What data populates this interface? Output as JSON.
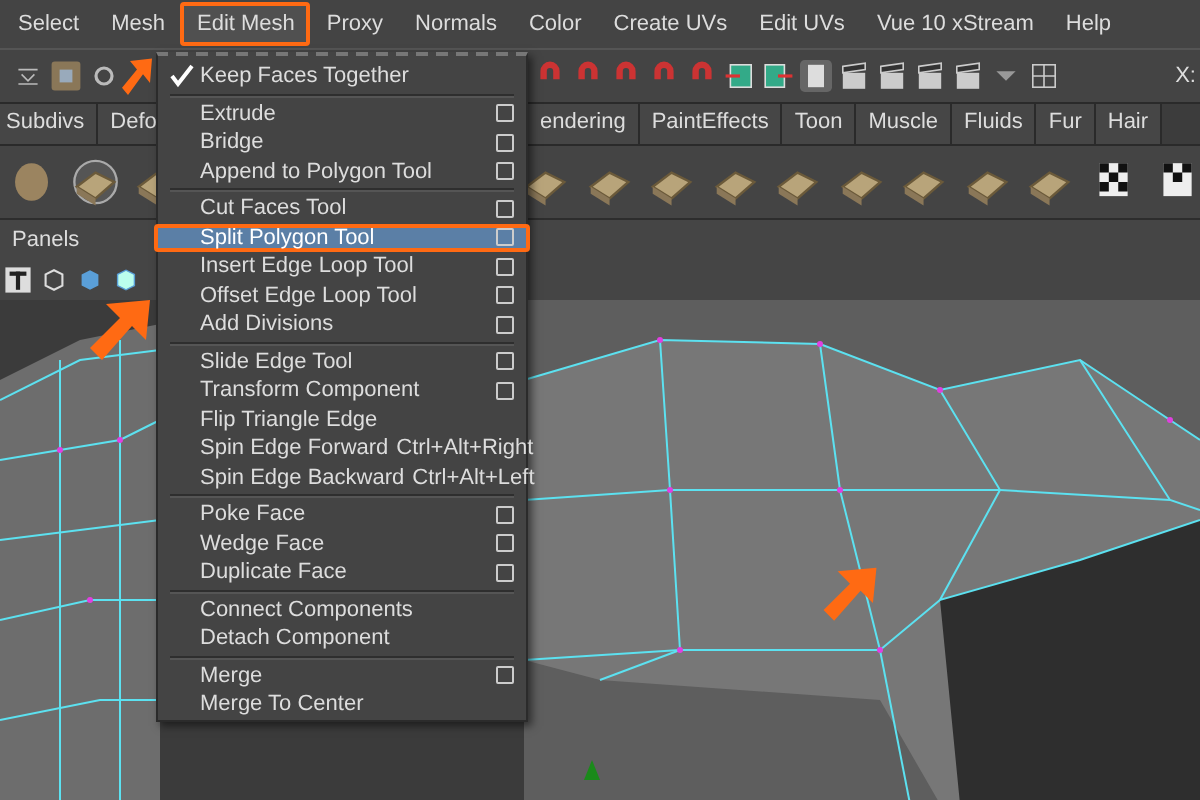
{
  "menu_bar": [
    {
      "label": "Select",
      "selected": false
    },
    {
      "label": "Mesh",
      "selected": false
    },
    {
      "label": "Edit Mesh",
      "selected": true
    },
    {
      "label": "Proxy",
      "selected": false
    },
    {
      "label": "Normals",
      "selected": false
    },
    {
      "label": "Color",
      "selected": false
    },
    {
      "label": "Create UVs",
      "selected": false
    },
    {
      "label": "Edit UVs",
      "selected": false
    },
    {
      "label": "Vue 10 xStream",
      "selected": false
    },
    {
      "label": "Help",
      "selected": false
    }
  ],
  "toolbar": {
    "coordinate_label": "X:"
  },
  "shelf_tabs": [
    {
      "label": "Subdivs"
    },
    {
      "label": "Defo"
    },
    {
      "label": "endering"
    },
    {
      "label": "PaintEffects"
    },
    {
      "label": "Toon"
    },
    {
      "label": "Muscle"
    },
    {
      "label": "Fluids"
    },
    {
      "label": "Fur"
    },
    {
      "label": "Hair"
    }
  ],
  "panel_bar": {
    "label": "Panels"
  },
  "dropdown_menu": {
    "groups": [
      [
        {
          "label": "Keep Faces Together",
          "checked": true,
          "option_box": false,
          "selected": false
        }
      ],
      [
        {
          "label": "Extrude",
          "checked": false,
          "option_box": true,
          "selected": false
        },
        {
          "label": "Bridge",
          "checked": false,
          "option_box": true,
          "selected": false
        },
        {
          "label": "Append to Polygon Tool",
          "checked": false,
          "option_box": true,
          "selected": false
        }
      ],
      [
        {
          "label": "Cut Faces Tool",
          "checked": false,
          "option_box": true,
          "selected": false
        },
        {
          "label": "Split Polygon Tool",
          "checked": false,
          "option_box": true,
          "selected": true
        },
        {
          "label": "Insert Edge Loop Tool",
          "checked": false,
          "option_box": true,
          "selected": false
        },
        {
          "label": "Offset Edge Loop Tool",
          "checked": false,
          "option_box": true,
          "selected": false
        },
        {
          "label": "Add Divisions",
          "checked": false,
          "option_box": true,
          "selected": false
        }
      ],
      [
        {
          "label": "Slide Edge Tool",
          "checked": false,
          "option_box": true,
          "selected": false
        },
        {
          "label": "Transform Component",
          "checked": false,
          "option_box": true,
          "selected": false
        },
        {
          "label": "Flip Triangle Edge",
          "checked": false,
          "option_box": false,
          "selected": false
        },
        {
          "label": "Spin Edge Forward",
          "shortcut": "Ctrl+Alt+Right",
          "checked": false,
          "option_box": false,
          "selected": false
        },
        {
          "label": "Spin Edge Backward",
          "shortcut": "Ctrl+Alt+Left",
          "checked": false,
          "option_box": false,
          "selected": false
        }
      ],
      [
        {
          "label": "Poke Face",
          "checked": false,
          "option_box": true,
          "selected": false
        },
        {
          "label": "Wedge Face",
          "checked": false,
          "option_box": true,
          "selected": false
        },
        {
          "label": "Duplicate Face",
          "checked": false,
          "option_box": true,
          "selected": false
        }
      ],
      [
        {
          "label": "Connect Components",
          "checked": false,
          "option_box": false,
          "selected": false
        },
        {
          "label": "Detach Component",
          "checked": false,
          "option_box": false,
          "selected": false
        }
      ],
      [
        {
          "label": "Merge",
          "checked": false,
          "option_box": true,
          "selected": false
        },
        {
          "label": "Merge To Center",
          "checked": false,
          "option_box": false,
          "selected": false
        }
      ]
    ]
  }
}
